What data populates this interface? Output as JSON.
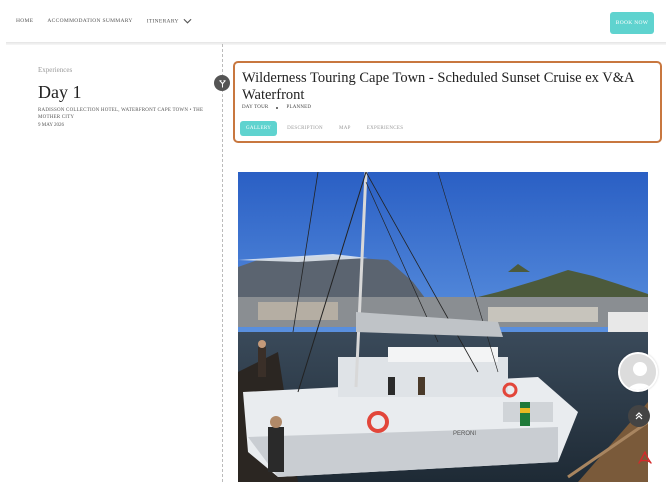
{
  "nav": {
    "items": [
      {
        "label": "HOME"
      },
      {
        "label": "ACCOMMODATION SUMMARY"
      },
      {
        "label": "ITINERARY"
      }
    ],
    "book_label": "BOOK NOW",
    "accent": "#5fd3cf"
  },
  "left": {
    "section_label": "Experiences",
    "day_title": "Day 1",
    "hotel": "RADISSON COLLECTION HOTEL, WATERFRONT CAPE TOWN • THE MOTHER CITY",
    "date": "9 MAY 2026"
  },
  "card": {
    "title": "Wilderness Touring Cape Town - Scheduled Sunset Cruise ex V&A Waterfront",
    "meta": [
      "DAY TOUR",
      "PLANNED"
    ],
    "tabs": [
      {
        "label": "GALLERY",
        "active": true
      },
      {
        "label": "DESCRIPTION",
        "active": false
      },
      {
        "label": "MAP",
        "active": false
      },
      {
        "label": "EXPERIENCES",
        "active": false
      }
    ],
    "border_color": "#c8773f"
  },
  "photo": {
    "boat_label": "PERONI"
  }
}
